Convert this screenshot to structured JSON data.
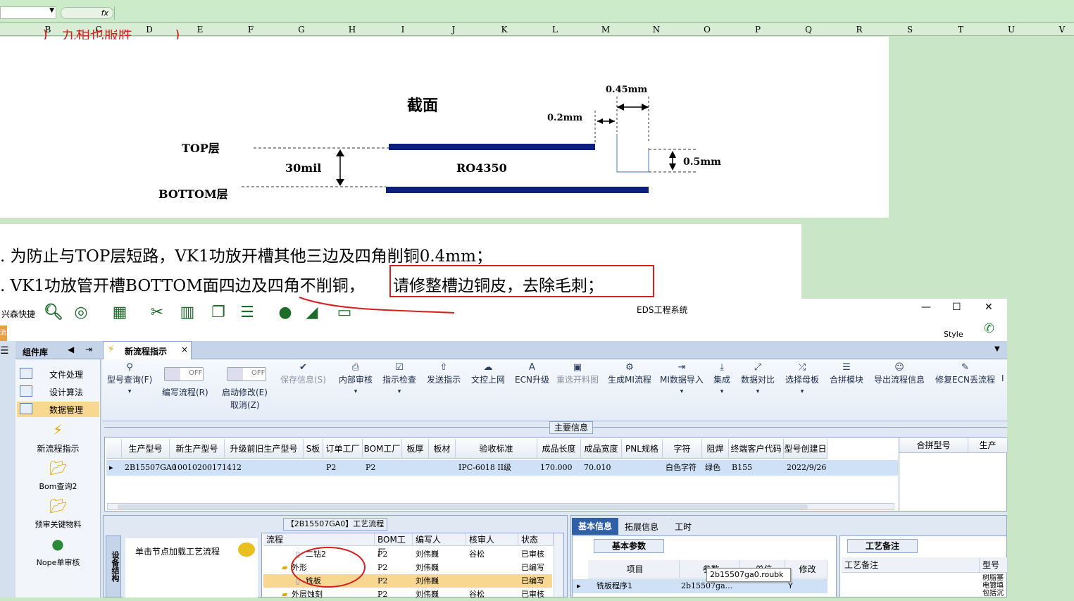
{
  "spreadsheet": {
    "fx_label": "fx",
    "columns": [
      "B",
      "C",
      "D",
      "E",
      "F",
      "G",
      "H",
      "I",
      "J",
      "K",
      "L",
      "M",
      "N",
      "O",
      "P",
      "Q",
      "R",
      "S",
      "T",
      "U",
      "V"
    ]
  },
  "slide": {
    "title": "截面",
    "dim_045": "0.45mm",
    "dim_02": "0.2mm",
    "top_label": "TOP层",
    "bottom_label": "BOTTOM层",
    "thickness": "30mil",
    "material": "RO4350",
    "dim_05": "0.5mm",
    "line1": ". 为防止与TOP层短路，VK1功放开槽其他三边及四角削铜0.4mm；",
    "line2_a": ". VK1功放管开槽BOTTOM面四边及四角不削铜，",
    "line2_b": "请修整槽边铜皮，去除毛刺；",
    "highlight_color": "#d42020"
  },
  "app": {
    "quickbar_label": "兴森快捷",
    "title": "EDS工程系统",
    "style_label": "Style",
    "min": "—",
    "max": "☐",
    "close": "✕",
    "left_tag": "流"
  },
  "tabs": {
    "panel_label": "组件库",
    "active_tab": "新流程指示",
    "tab_close": "×"
  },
  "sidebar": {
    "items": [
      "文件处理",
      "设计算法",
      "数据管理"
    ],
    "tools": [
      "新流程指示",
      "Bom查询2",
      "预审关键物料",
      "Nope单审核"
    ]
  },
  "ribbon": {
    "query": "型号查询(F)",
    "edit_flow": "编写流程(R)",
    "start_modify": "启动修改(E)",
    "cancel": "取消(Z)",
    "off": "OFF",
    "buttons": [
      "保存信息(S)",
      "内部审核",
      "指示检查",
      "发送指示",
      "文控上网",
      "ECN升级",
      "重选开料图",
      "生成MI流程",
      "MI数据导入",
      "集成",
      "数据对比",
      "选择母板",
      "合拼模块",
      "导出流程信息",
      "修复ECN丢流程"
    ],
    "tail": "I"
  },
  "main_info": {
    "title": "主要信息",
    "headers": [
      "生产型号",
      "新生产型号",
      "升级前旧生产型号",
      "S板",
      "订单工厂",
      "BOM工厂",
      "板厚",
      "板材",
      "验收标准",
      "成品长度",
      "成品宽度",
      "PNL规格",
      "字符",
      "阻焊",
      "终端客户代码",
      "型号创建日"
    ],
    "row": [
      "2B15507GA0",
      "10010200171412",
      "",
      "",
      "P2",
      "P2",
      "",
      "",
      "IPC-6018 II级",
      "170.000",
      "70.010",
      "",
      "白色字符",
      "绿色",
      "B155",
      "2022/9/26"
    ],
    "right_headers": [
      "合拼型号",
      "生产"
    ]
  },
  "process": {
    "title": "【2B15507GA0】工艺流程",
    "vtab": "设备结构",
    "hint": "单击节点加载工艺流程",
    "headers": [
      "流程",
      "BOM工厂",
      "编写人",
      "核审人",
      "状态"
    ],
    "rows": [
      {
        "name": "二钻2",
        "bom": "P2",
        "writer": "刘伟巍",
        "checker": "谷松",
        "status": "已审核"
      },
      {
        "name": "外形",
        "bom": "P2",
        "writer": "刘伟巍",
        "checker": "",
        "status": "已编写"
      },
      {
        "name": "铣板",
        "bom": "P2",
        "writer": "刘伟巍",
        "checker": "",
        "status": "已编写"
      },
      {
        "name": "外层蚀刻",
        "bom": "P2",
        "writer": "刘伟巍",
        "checker": "谷松",
        "status": "已审核"
      }
    ]
  },
  "info_tabs": {
    "tabs": [
      "基本信息",
      "拓展信息",
      "工时"
    ],
    "basic_params": "基本参数",
    "param_headers": [
      "项目",
      "参数",
      "单位",
      "修改"
    ],
    "row": [
      "铣板程序1",
      "2b15507ga...",
      "",
      "Y"
    ],
    "tooltip": "2b15507ga0.roubk",
    "remark_title": "工艺备注",
    "remark_header": "工艺备注",
    "model_header": "型号备",
    "side_text": "树脂塞 电镀填 包括沉"
  }
}
